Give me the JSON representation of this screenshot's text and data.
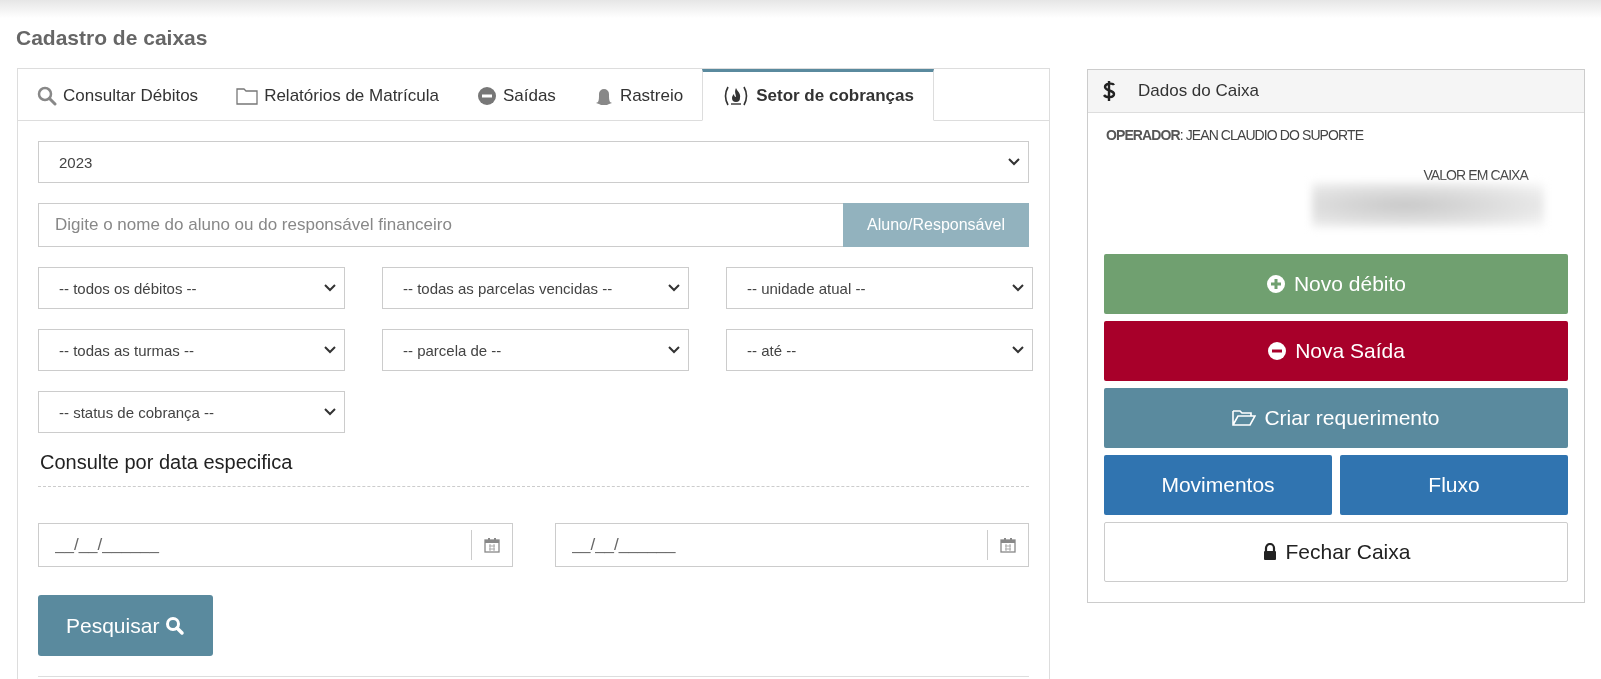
{
  "page_title": "Cadastro de caixas",
  "tabs": [
    {
      "label": "Consultar Débitos",
      "selected": false
    },
    {
      "label": "Relatórios de Matrícula",
      "selected": false
    },
    {
      "label": "Saídas",
      "selected": false
    },
    {
      "label": "Rastreio",
      "selected": false
    },
    {
      "label": "Setor de cobranças",
      "selected": true
    }
  ],
  "year_select": {
    "value": "2023"
  },
  "search": {
    "placeholder": "Digite o nome do aluno ou do responsável financeiro",
    "button": "Aluno/Responsável"
  },
  "filters": [
    {
      "value": "-- todos os débitos --"
    },
    {
      "value": "-- todas as parcelas vencidas --"
    },
    {
      "value": "-- unidade atual --"
    },
    {
      "value": "-- todas as turmas --"
    },
    {
      "value": "-- parcela de --"
    },
    {
      "value": "-- até --"
    },
    {
      "value": "-- status de cobrança --"
    }
  ],
  "date_section": {
    "heading": "Consulte por data especifica",
    "fields": [
      {
        "placeholder": "__/__/______"
      },
      {
        "placeholder": "__/__/______"
      }
    ]
  },
  "search_button": "Pesquisar",
  "cash_panel": {
    "title": "Dados do Caixa",
    "operator_label": "OPERADOR",
    "operator_name": ": JEAN CLAUDIO DO SUPORTE",
    "balance_label": "VALOR EM CAIXA",
    "buttons": [
      {
        "label": "Novo débito",
        "kind": "success"
      },
      {
        "label": "Nova Saída",
        "kind": "danger"
      },
      {
        "label": "Criar requerimento",
        "kind": "info"
      },
      {
        "label": "Movimentos",
        "kind": "primary"
      },
      {
        "label": "Fluxo",
        "kind": "primary"
      },
      {
        "label": "Fechar Caixa",
        "kind": "default"
      }
    ]
  }
}
